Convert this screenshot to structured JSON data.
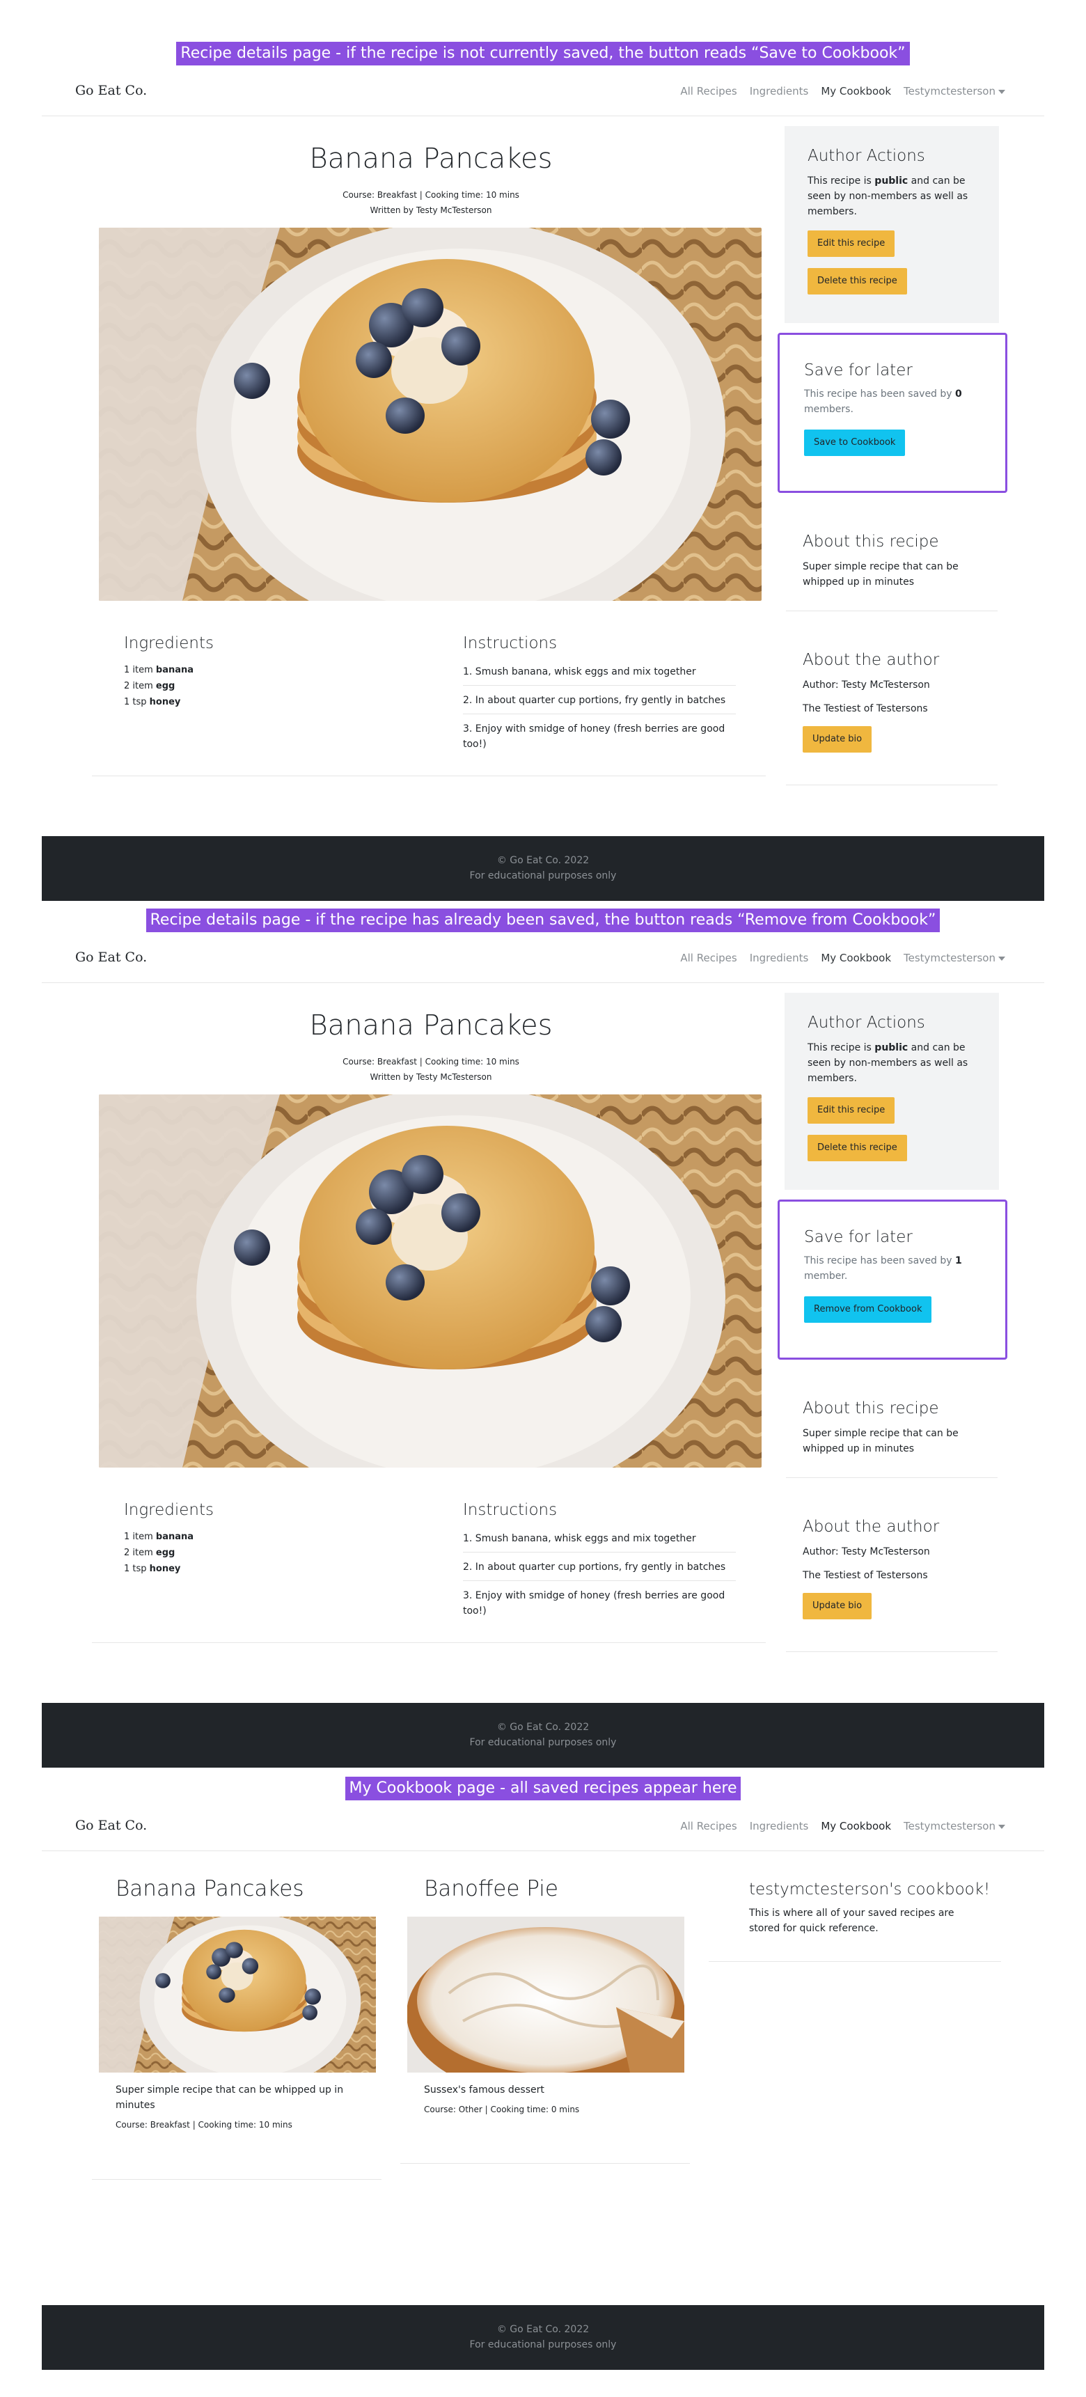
{
  "captions": [
    "Recipe details page - if the recipe is not currently saved, the button reads “Save to Cookbook”",
    "Recipe details page - if the recipe has already been saved, the button reads “Remove from Cookbook”",
    "My Cookbook page - all saved recipes appear here"
  ],
  "nav": {
    "brand": "Go Eat Co.",
    "links": [
      "All Recipes",
      "Ingredients",
      "My Cookbook",
      "Testymctesterson"
    ]
  },
  "recipe": {
    "title": "Banana Pancakes",
    "meta": "Course: Breakfast | Cooking time: 10 mins",
    "author_line": "Written by Testy McTesterson",
    "ingredients_heading": "Ingredients",
    "ingredients": [
      {
        "qty": "1 item ",
        "name": "banana"
      },
      {
        "qty": "2 item ",
        "name": "egg"
      },
      {
        "qty": "1 tsp ",
        "name": "honey"
      }
    ],
    "instructions_heading": "Instructions",
    "instructions": [
      "1. Smush banana, whisk eggs and mix together",
      "2. In about quarter cup portions, fry gently in batches",
      "3. Enjoy with smidge of honey (fresh berries are good too!)"
    ]
  },
  "author_actions": {
    "heading": "Author Actions",
    "text_before": "This recipe is ",
    "text_bold": "public",
    "text_after": " and can be seen by non-members as well as members.",
    "edit_label": "Edit this recipe",
    "delete_label": "Delete this recipe"
  },
  "save_box_1": {
    "heading": "Save for later",
    "text_before": "This recipe has been saved by ",
    "count": "0",
    "text_after": " members.",
    "button": "Save to Cookbook"
  },
  "save_box_2": {
    "heading": "Save for later",
    "text_before": "This recipe has been saved by ",
    "count": "1",
    "text_after": " member.",
    "button": "Remove from Cookbook"
  },
  "about_recipe": {
    "heading": "About this recipe",
    "text": "Super simple recipe that can be whipped up in minutes"
  },
  "about_author": {
    "heading": "About the author",
    "author": "Author: Testy McTesterson",
    "bio": "The Testiest of Testersons",
    "button": "Update bio"
  },
  "footer": {
    "line1": "© Go Eat Co. 2022",
    "line2": "For educational purposes only"
  },
  "cookbook": {
    "cards": [
      {
        "title": "Banana Pancakes",
        "description": "Super simple recipe that can be whipped up in minutes",
        "meta": "Course: Breakfast | Cooking time: 10 mins"
      },
      {
        "title": "Banoffee Pie",
        "description": "Sussex's famous dessert",
        "meta": "Course: Other | Cooking time: 0 mins"
      }
    ],
    "sidebar_heading": "testymctesterson's cookbook!",
    "sidebar_text": "This is where all of your saved recipes are stored for quick reference."
  }
}
